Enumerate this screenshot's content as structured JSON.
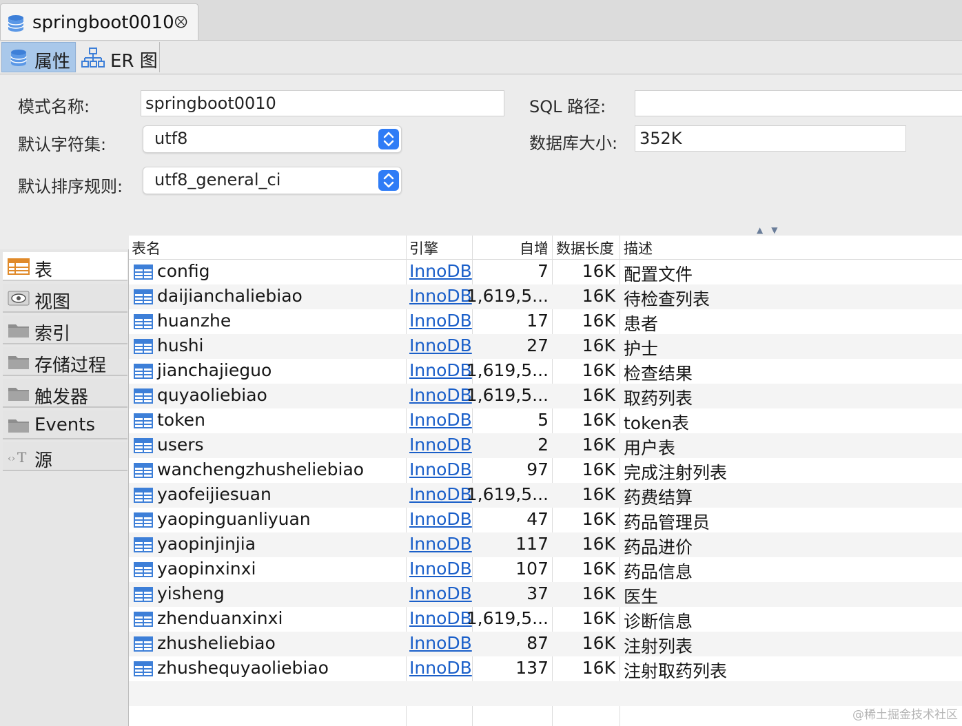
{
  "editor_tab": {
    "title": "springboot0010",
    "close_glyph": "⮾"
  },
  "subtabs": [
    {
      "label": "属性",
      "icon": "database-icon",
      "active": true
    },
    {
      "label": "ER 图",
      "icon": "er-diagram-icon",
      "active": false
    }
  ],
  "form": {
    "schema_name_label": "模式名称:",
    "schema_name_value": "springboot0010",
    "sql_path_label": "SQL 路径:",
    "sql_path_value": "",
    "charset_label": "默认字符集:",
    "charset_value": "utf8",
    "db_size_label": "数据库大小:",
    "db_size_value": "352K",
    "collation_label": "默认排序规则:",
    "collation_value": "utf8_general_ci"
  },
  "sidebar": {
    "items": [
      {
        "label": "表",
        "icon": "table-icon",
        "active": true
      },
      {
        "label": "视图",
        "icon": "eye-icon",
        "active": false
      },
      {
        "label": "索引",
        "icon": "folder-icon",
        "active": false
      },
      {
        "label": "存储过程",
        "icon": "folder-icon",
        "active": false
      },
      {
        "label": "触发器",
        "icon": "folder-icon",
        "active": false
      },
      {
        "label": "Events",
        "icon": "folder-icon",
        "active": false
      },
      {
        "label": "源",
        "icon": "source-icon",
        "active": false
      }
    ]
  },
  "table": {
    "headers": [
      "表名",
      "引擎",
      "自增",
      "数据长度",
      "描述"
    ],
    "rows": [
      {
        "name": "config",
        "engine": "InnoDB",
        "auto_inc": "7",
        "data_len": "16K",
        "desc": "配置文件"
      },
      {
        "name": "daijianchaliebiao",
        "engine": "InnoDB",
        "auto_inc": "1,619,5...",
        "data_len": "16K",
        "desc": "待检查列表"
      },
      {
        "name": "huanzhe",
        "engine": "InnoDB",
        "auto_inc": "17",
        "data_len": "16K",
        "desc": "患者"
      },
      {
        "name": "hushi",
        "engine": "InnoDB",
        "auto_inc": "27",
        "data_len": "16K",
        "desc": "护士"
      },
      {
        "name": "jianchajieguo",
        "engine": "InnoDB",
        "auto_inc": "1,619,5...",
        "data_len": "16K",
        "desc": "检查结果"
      },
      {
        "name": "quyaoliebiao",
        "engine": "InnoDB",
        "auto_inc": "1,619,5...",
        "data_len": "16K",
        "desc": "取药列表"
      },
      {
        "name": "token",
        "engine": "InnoDB",
        "auto_inc": "5",
        "data_len": "16K",
        "desc": "token表"
      },
      {
        "name": "users",
        "engine": "InnoDB",
        "auto_inc": "2",
        "data_len": "16K",
        "desc": "用户表"
      },
      {
        "name": "wanchengzhusheliebiao",
        "engine": "InnoDB",
        "auto_inc": "97",
        "data_len": "16K",
        "desc": "完成注射列表"
      },
      {
        "name": "yaofeijiesuan",
        "engine": "InnoDB",
        "auto_inc": "1,619,5...",
        "data_len": "16K",
        "desc": "药费结算"
      },
      {
        "name": "yaopinguanliyuan",
        "engine": "InnoDB",
        "auto_inc": "47",
        "data_len": "16K",
        "desc": "药品管理员"
      },
      {
        "name": "yaopinjinjia",
        "engine": "InnoDB",
        "auto_inc": "117",
        "data_len": "16K",
        "desc": "药品进价"
      },
      {
        "name": "yaopinxinxi",
        "engine": "InnoDB",
        "auto_inc": "107",
        "data_len": "16K",
        "desc": "药品信息"
      },
      {
        "name": "yisheng",
        "engine": "InnoDB",
        "auto_inc": "37",
        "data_len": "16K",
        "desc": "医生"
      },
      {
        "name": "zhenduanxinxi",
        "engine": "InnoDB",
        "auto_inc": "1,619,5...",
        "data_len": "16K",
        "desc": "诊断信息"
      },
      {
        "name": "zhusheliebiao",
        "engine": "InnoDB",
        "auto_inc": "87",
        "data_len": "16K",
        "desc": "注射列表"
      },
      {
        "name": "zhushequyaoliebiao",
        "engine": "InnoDB",
        "auto_inc": "137",
        "data_len": "16K",
        "desc": "注射取药列表"
      }
    ]
  },
  "watermark": "@稀土掘金技术社区",
  "colors": {
    "accent": "#2f7cf6",
    "link": "#1a5fc9",
    "selected_tab": "#a9c8ea",
    "table_icon": "#3d7fd8"
  }
}
